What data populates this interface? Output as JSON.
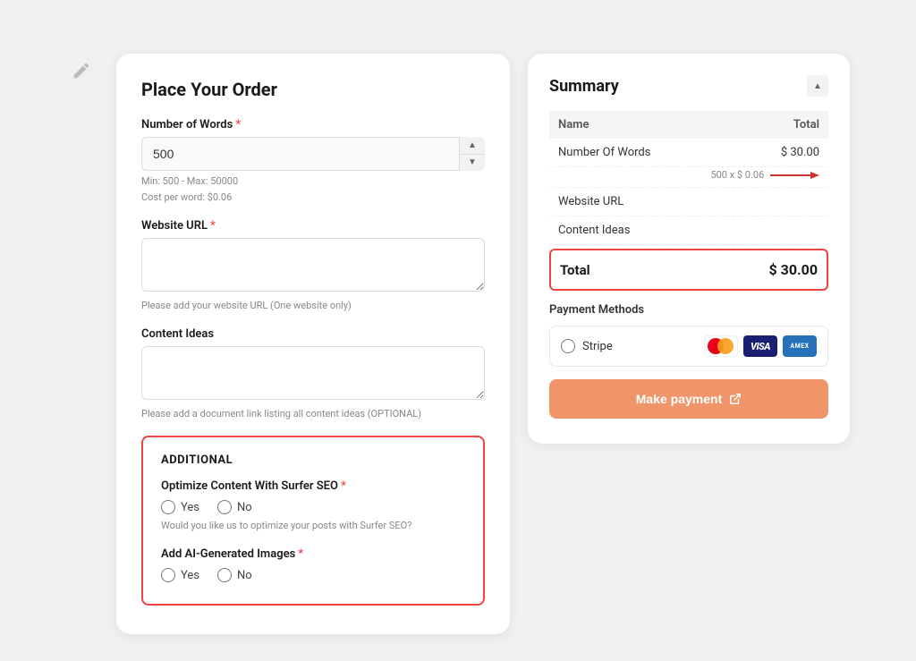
{
  "editIcon": "✏",
  "leftPanel": {
    "title": "Place Your Order",
    "wordCount": {
      "label": "Number of Words",
      "required": true,
      "value": "500",
      "min_hint": "Min: 500 - Max: 50000",
      "cost_hint": "Cost per word: $0.06"
    },
    "websiteUrl": {
      "label": "Website URL",
      "required": true,
      "placeholder": "",
      "hint": "Please add your website URL (One website only)"
    },
    "contentIdeas": {
      "label": "Content Ideas",
      "hint": "Please add a document link listing all content ideas (OPTIONAL)"
    },
    "additional": {
      "title": "ADDITIONAL",
      "surferSeo": {
        "label": "Optimize Content With Surfer SEO",
        "required": true,
        "yes_label": "Yes",
        "no_label": "No",
        "hint": "Would you like us to optimize your posts with Surfer SEO?"
      },
      "aiImages": {
        "label": "Add AI-Generated Images",
        "required": true,
        "yes_label": "Yes",
        "no_label": "No"
      }
    }
  },
  "rightPanel": {
    "title": "Summary",
    "collapseLabel": "▲",
    "table": {
      "headers": {
        "name": "Name",
        "total": "Total"
      },
      "rows": [
        {
          "name": "Number Of Words",
          "sub": "500 x $ 0.06",
          "total": "$ 30.00",
          "hasArrow": true
        },
        {
          "name": "Website URL",
          "sub": "",
          "total": ""
        },
        {
          "name": "Content Ideas",
          "sub": "",
          "total": ""
        }
      ]
    },
    "total": {
      "label": "Total",
      "value": "$ 30.00"
    },
    "paymentMethods": {
      "title": "Payment Methods",
      "options": [
        {
          "id": "stripe",
          "name": "Stripe",
          "cards": [
            "mastercard",
            "visa",
            "amex"
          ]
        }
      ]
    },
    "makePaymentBtn": "Make payment"
  }
}
